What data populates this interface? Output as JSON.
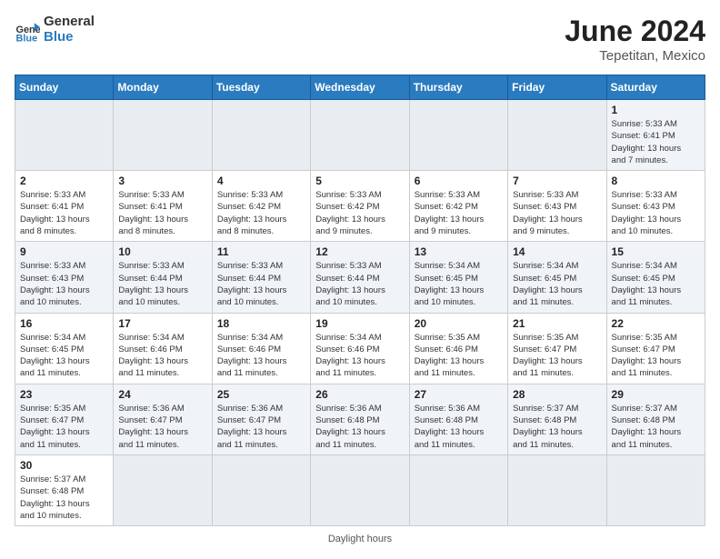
{
  "header": {
    "logo_general": "General",
    "logo_blue": "Blue",
    "month_title": "June 2024",
    "location": "Tepetitan, Mexico"
  },
  "days_of_week": [
    "Sunday",
    "Monday",
    "Tuesday",
    "Wednesday",
    "Thursday",
    "Friday",
    "Saturday"
  ],
  "weeks": [
    [
      {
        "day": "",
        "info": ""
      },
      {
        "day": "",
        "info": ""
      },
      {
        "day": "",
        "info": ""
      },
      {
        "day": "",
        "info": ""
      },
      {
        "day": "",
        "info": ""
      },
      {
        "day": "",
        "info": ""
      },
      {
        "day": "1",
        "info": "Sunrise: 5:33 AM\nSunset: 6:41 PM\nDaylight: 13 hours\nand 7 minutes."
      }
    ],
    [
      {
        "day": "2",
        "info": "Sunrise: 5:33 AM\nSunset: 6:41 PM\nDaylight: 13 hours\nand 8 minutes."
      },
      {
        "day": "3",
        "info": "Sunrise: 5:33 AM\nSunset: 6:41 PM\nDaylight: 13 hours\nand 8 minutes."
      },
      {
        "day": "4",
        "info": "Sunrise: 5:33 AM\nSunset: 6:42 PM\nDaylight: 13 hours\nand 8 minutes."
      },
      {
        "day": "5",
        "info": "Sunrise: 5:33 AM\nSunset: 6:42 PM\nDaylight: 13 hours\nand 9 minutes."
      },
      {
        "day": "6",
        "info": "Sunrise: 5:33 AM\nSunset: 6:42 PM\nDaylight: 13 hours\nand 9 minutes."
      },
      {
        "day": "7",
        "info": "Sunrise: 5:33 AM\nSunset: 6:43 PM\nDaylight: 13 hours\nand 9 minutes."
      },
      {
        "day": "8",
        "info": "Sunrise: 5:33 AM\nSunset: 6:43 PM\nDaylight: 13 hours\nand 10 minutes."
      }
    ],
    [
      {
        "day": "9",
        "info": "Sunrise: 5:33 AM\nSunset: 6:43 PM\nDaylight: 13 hours\nand 10 minutes."
      },
      {
        "day": "10",
        "info": "Sunrise: 5:33 AM\nSunset: 6:44 PM\nDaylight: 13 hours\nand 10 minutes."
      },
      {
        "day": "11",
        "info": "Sunrise: 5:33 AM\nSunset: 6:44 PM\nDaylight: 13 hours\nand 10 minutes."
      },
      {
        "day": "12",
        "info": "Sunrise: 5:33 AM\nSunset: 6:44 PM\nDaylight: 13 hours\nand 10 minutes."
      },
      {
        "day": "13",
        "info": "Sunrise: 5:34 AM\nSunset: 6:45 PM\nDaylight: 13 hours\nand 10 minutes."
      },
      {
        "day": "14",
        "info": "Sunrise: 5:34 AM\nSunset: 6:45 PM\nDaylight: 13 hours\nand 11 minutes."
      },
      {
        "day": "15",
        "info": "Sunrise: 5:34 AM\nSunset: 6:45 PM\nDaylight: 13 hours\nand 11 minutes."
      }
    ],
    [
      {
        "day": "16",
        "info": "Sunrise: 5:34 AM\nSunset: 6:45 PM\nDaylight: 13 hours\nand 11 minutes."
      },
      {
        "day": "17",
        "info": "Sunrise: 5:34 AM\nSunset: 6:46 PM\nDaylight: 13 hours\nand 11 minutes."
      },
      {
        "day": "18",
        "info": "Sunrise: 5:34 AM\nSunset: 6:46 PM\nDaylight: 13 hours\nand 11 minutes."
      },
      {
        "day": "19",
        "info": "Sunrise: 5:34 AM\nSunset: 6:46 PM\nDaylight: 13 hours\nand 11 minutes."
      },
      {
        "day": "20",
        "info": "Sunrise: 5:35 AM\nSunset: 6:46 PM\nDaylight: 13 hours\nand 11 minutes."
      },
      {
        "day": "21",
        "info": "Sunrise: 5:35 AM\nSunset: 6:47 PM\nDaylight: 13 hours\nand 11 minutes."
      },
      {
        "day": "22",
        "info": "Sunrise: 5:35 AM\nSunset: 6:47 PM\nDaylight: 13 hours\nand 11 minutes."
      }
    ],
    [
      {
        "day": "23",
        "info": "Sunrise: 5:35 AM\nSunset: 6:47 PM\nDaylight: 13 hours\nand 11 minutes."
      },
      {
        "day": "24",
        "info": "Sunrise: 5:36 AM\nSunset: 6:47 PM\nDaylight: 13 hours\nand 11 minutes."
      },
      {
        "day": "25",
        "info": "Sunrise: 5:36 AM\nSunset: 6:47 PM\nDaylight: 13 hours\nand 11 minutes."
      },
      {
        "day": "26",
        "info": "Sunrise: 5:36 AM\nSunset: 6:48 PM\nDaylight: 13 hours\nand 11 minutes."
      },
      {
        "day": "27",
        "info": "Sunrise: 5:36 AM\nSunset: 6:48 PM\nDaylight: 13 hours\nand 11 minutes."
      },
      {
        "day": "28",
        "info": "Sunrise: 5:37 AM\nSunset: 6:48 PM\nDaylight: 13 hours\nand 11 minutes."
      },
      {
        "day": "29",
        "info": "Sunrise: 5:37 AM\nSunset: 6:48 PM\nDaylight: 13 hours\nand 11 minutes."
      }
    ],
    [
      {
        "day": "30",
        "info": "Sunrise: 5:37 AM\nSunset: 6:48 PM\nDaylight: 13 hours\nand 10 minutes."
      },
      {
        "day": "",
        "info": ""
      },
      {
        "day": "",
        "info": ""
      },
      {
        "day": "",
        "info": ""
      },
      {
        "day": "",
        "info": ""
      },
      {
        "day": "",
        "info": ""
      },
      {
        "day": "",
        "info": ""
      }
    ]
  ],
  "bottom_note": "Daylight hours"
}
